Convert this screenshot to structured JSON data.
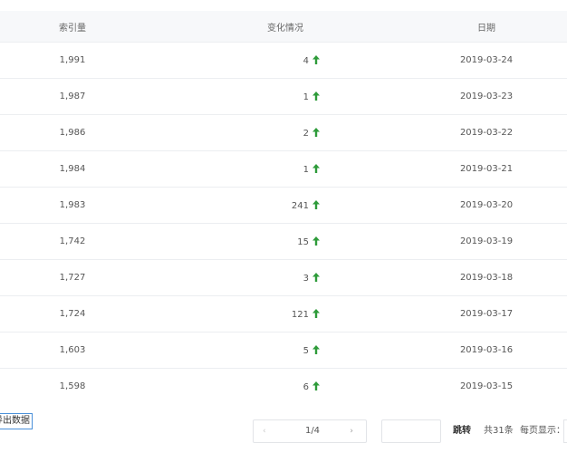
{
  "table": {
    "headers": {
      "index": "索引量",
      "change": "变化情况",
      "date": "日期"
    },
    "rows": [
      {
        "index": "1,991",
        "change": "4",
        "date": "2019-03-24"
      },
      {
        "index": "1,987",
        "change": "1",
        "date": "2019-03-23"
      },
      {
        "index": "1,986",
        "change": "2",
        "date": "2019-03-22"
      },
      {
        "index": "1,984",
        "change": "1",
        "date": "2019-03-21"
      },
      {
        "index": "1,983",
        "change": "241",
        "date": "2019-03-20"
      },
      {
        "index": "1,742",
        "change": "15",
        "date": "2019-03-19"
      },
      {
        "index": "1,727",
        "change": "3",
        "date": "2019-03-18"
      },
      {
        "index": "1,724",
        "change": "121",
        "date": "2019-03-17"
      },
      {
        "index": "1,603",
        "change": "5",
        "date": "2019-03-16"
      },
      {
        "index": "1,598",
        "change": "6",
        "date": "2019-03-15"
      }
    ],
    "change_icon": "arrow-up-icon",
    "up_color": "#2e9b3a"
  },
  "footer": {
    "export_label": "导出数据",
    "pager": {
      "prev_icon": "chevron-left-icon",
      "next_icon": "chevron-right-icon",
      "page": "1/4"
    },
    "jump_label": "跳转",
    "total": "共31条",
    "per_page_label": "每页显示："
  }
}
